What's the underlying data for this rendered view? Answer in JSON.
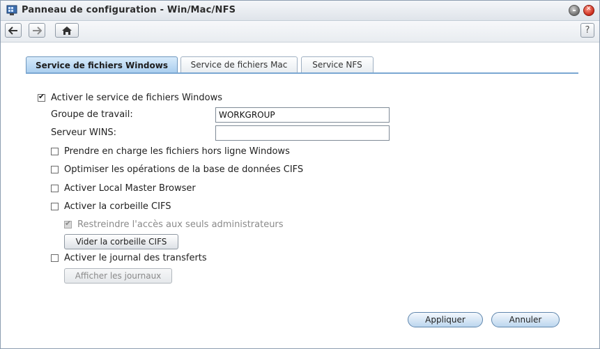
{
  "window": {
    "title": "Panneau de configuration - Win/Mac/NFS",
    "icons": {
      "app": "control-panel-icon",
      "minimize": "minimize-icon",
      "close": "close-icon"
    }
  },
  "toolbar": {
    "back_icon": "arrow-left-icon",
    "forward_icon": "arrow-right-icon",
    "home_icon": "home-icon",
    "help_label": "?"
  },
  "tabs": [
    {
      "label": "Service de fichiers Windows",
      "active": true
    },
    {
      "label": "Service de fichiers Mac",
      "active": false
    },
    {
      "label": "Service NFS",
      "active": false
    }
  ],
  "form": {
    "enable_windows": {
      "label": "Activer le service de fichiers Windows",
      "checked": true
    },
    "workgroup": {
      "label": "Groupe de travail:",
      "value": "WORKGROUP"
    },
    "wins": {
      "label": "Serveur WINS:",
      "value": ""
    },
    "offline_files": {
      "label": "Prendre en charge les fichiers hors ligne Windows",
      "checked": false
    },
    "optimize_cifs": {
      "label": "Optimiser les opérations de la base de données CIFS",
      "checked": false
    },
    "local_master": {
      "label": "Activer Local Master Browser",
      "checked": false
    },
    "recycle_bin": {
      "label": "Activer la corbeille CIFS",
      "checked": false
    },
    "restrict_admin": {
      "label": "Restreindre l'accès aux seuls administrateurs",
      "checked": true,
      "disabled": true
    },
    "empty_bin_button": "Vider la corbeille CIFS",
    "transfer_log": {
      "label": "Activer le journal des transferts",
      "checked": false
    },
    "show_logs_button": "Afficher les journaux"
  },
  "actions": {
    "apply": "Appliquer",
    "cancel": "Annuler"
  },
  "colors": {
    "accent": "#7aa7d2",
    "tab_active": "#a8cdee"
  }
}
